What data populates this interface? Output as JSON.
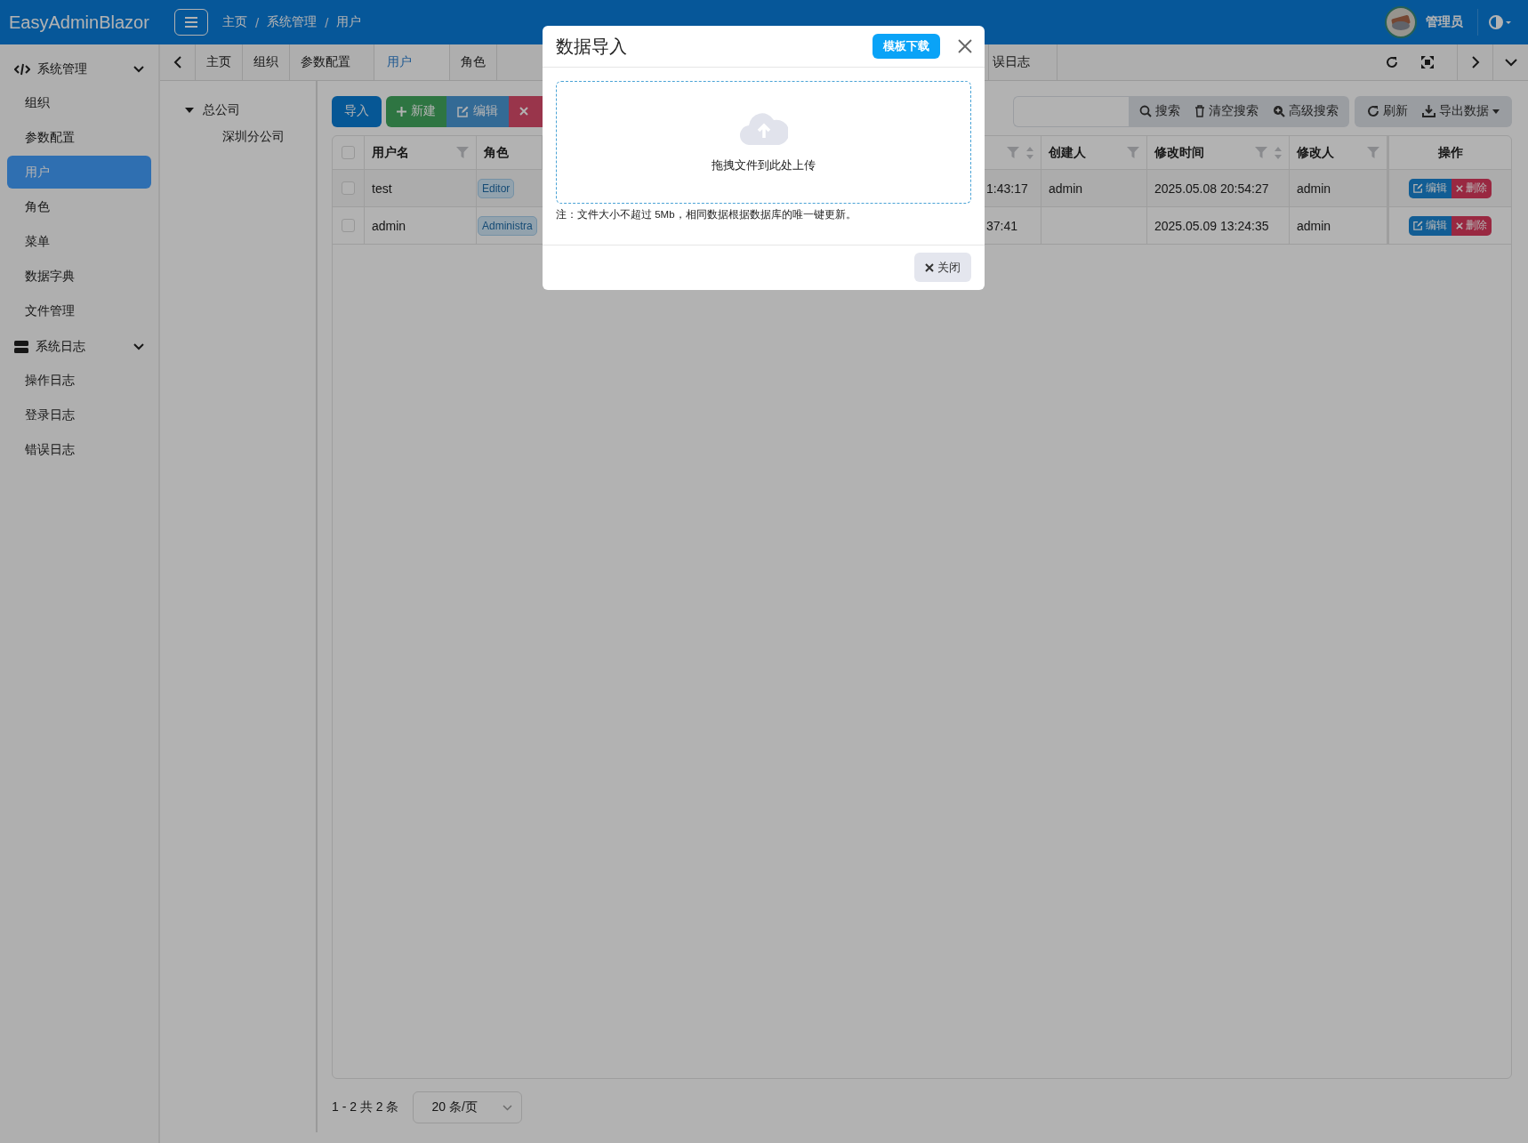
{
  "app": {
    "title": "EasyAdminBlazor"
  },
  "breadcrumb": [
    {
      "kind": "link",
      "label": "主页"
    },
    {
      "kind": "separator",
      "label": "/"
    },
    {
      "kind": "link",
      "label": "系统管理"
    },
    {
      "kind": "separator",
      "label": "/"
    },
    {
      "kind": "link",
      "label": "用户"
    }
  ],
  "user": {
    "name": "管理员"
  },
  "sidebar": {
    "groups": [
      {
        "label": "系统管理",
        "kind": "code",
        "expanded": true,
        "items": [
          {
            "label": "组织",
            "selected": false
          },
          {
            "label": "参数配置",
            "selected": false
          },
          {
            "label": "用户",
            "selected": true
          },
          {
            "label": "角色",
            "selected": false
          },
          {
            "label": "菜单",
            "selected": false
          },
          {
            "label": "数据字典",
            "selected": false
          },
          {
            "label": "文件管理",
            "selected": false
          }
        ]
      },
      {
        "label": "系统日志",
        "kind": "server",
        "expanded": true,
        "items": [
          {
            "label": "操作日志",
            "selected": false
          },
          {
            "label": "登录日志",
            "selected": false
          },
          {
            "label": "错误日志",
            "selected": false
          }
        ]
      }
    ]
  },
  "tabs": [
    {
      "label": "主页",
      "selected": false
    },
    {
      "label": "组织",
      "selected": false
    },
    {
      "label": "参数配置",
      "selected": false
    },
    {
      "label": "用户",
      "selected": true
    },
    {
      "label": "角色",
      "selected": false
    },
    {
      "label": "误日志",
      "selected": false
    }
  ],
  "tree": [
    {
      "label": "总公司",
      "expanded": true,
      "children": [
        {
          "label": "深圳分公司"
        }
      ]
    }
  ],
  "toolbar": {
    "actions": [
      {
        "kind": "import",
        "label": "导入"
      },
      {
        "kind": "new",
        "label": "新建"
      },
      {
        "kind": "edit",
        "label": "编辑"
      },
      {
        "kind": "delete"
      }
    ],
    "search": [
      {
        "kind": "search",
        "label": "搜索"
      },
      {
        "kind": "clear",
        "label": "清空搜索"
      },
      {
        "kind": "advanced",
        "label": "高级搜索"
      }
    ],
    "tools": [
      {
        "kind": "refresh",
        "label": "刷新"
      },
      {
        "kind": "export",
        "label": "导出数据"
      }
    ]
  },
  "table": {
    "columns": [
      {
        "label": "用户名",
        "filter": true,
        "sort": false
      },
      {
        "label": "角色",
        "filter": false,
        "sort": false
      },
      {
        "filter": true,
        "sort": true
      },
      {
        "label": "创建人",
        "filter": true,
        "sort": false
      },
      {
        "label": "修改时间",
        "filter": true,
        "sort": true
      },
      {
        "label": "修改人",
        "filter": true,
        "sort": false
      },
      {
        "label": "操作",
        "filter": false,
        "sort": false
      }
    ],
    "header_checked": false,
    "rows": [
      {
        "checked": false,
        "username": "test",
        "role": "Editor",
        "column_3": "1:43:17",
        "creator": "admin",
        "modified_time": "2025.05.08 20:54:27",
        "modifier": "admin",
        "actions": [
          "编辑",
          "删除"
        ]
      },
      {
        "checked": false,
        "username": "admin",
        "role": "Administra",
        "column_3": "37:41",
        "modified_time": "2025.05.09 13:24:35",
        "modifier": "admin",
        "actions": [
          "编辑",
          "删除"
        ]
      }
    ]
  },
  "pagination": {
    "summary": "1 - 2 共 2 条",
    "page_size": "20 条/页"
  },
  "modal": {
    "title": "数据导入",
    "template_button": "模板下载",
    "drop_text": "拖拽文件到此处上传",
    "note": "注：文件大小不超过 5Mb，相同数据根据数据库的唯一键更新。",
    "close_button": "关闭"
  }
}
